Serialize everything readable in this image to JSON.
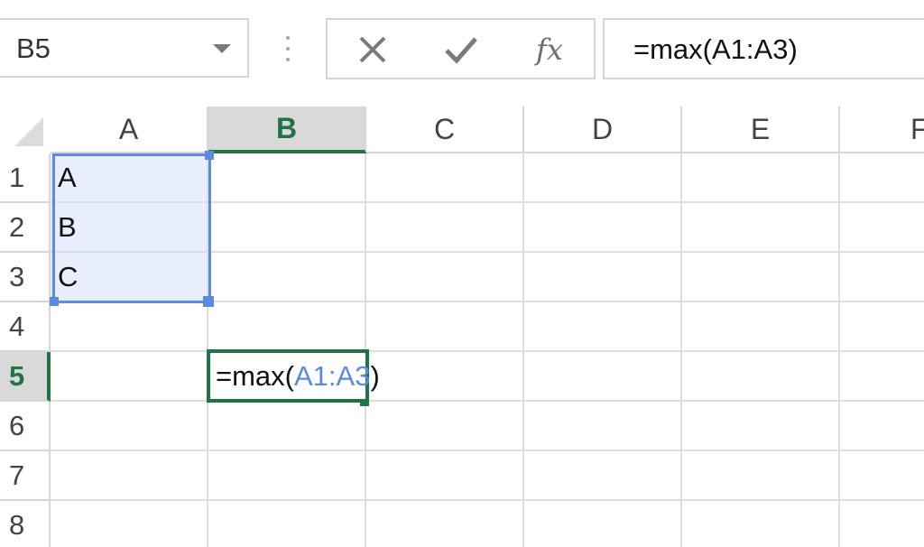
{
  "name_box": {
    "value": "B5",
    "dropdown_icon": "chevron-down-icon"
  },
  "formula_bar": {
    "cancel_icon": "close-icon",
    "enter_icon": "checkmark-icon",
    "function_label": "fx",
    "value": "=max(A1:A3)"
  },
  "grid": {
    "columns": [
      "A",
      "B",
      "C",
      "D",
      "E",
      "F"
    ],
    "rows": [
      "1",
      "2",
      "3",
      "4",
      "5",
      "6",
      "7",
      "8"
    ],
    "active_column": "B",
    "active_row": "5",
    "cells": {
      "A1": "A",
      "A2": "B",
      "A3": "C"
    },
    "edit_cell": {
      "address": "B5",
      "prefix": "=max(",
      "reference": "A1:A3",
      "suffix": ")"
    }
  },
  "colors": {
    "excel_green": "#217346",
    "reference_blue": "#5b8be0",
    "reference_fill": "#e8eefb"
  }
}
